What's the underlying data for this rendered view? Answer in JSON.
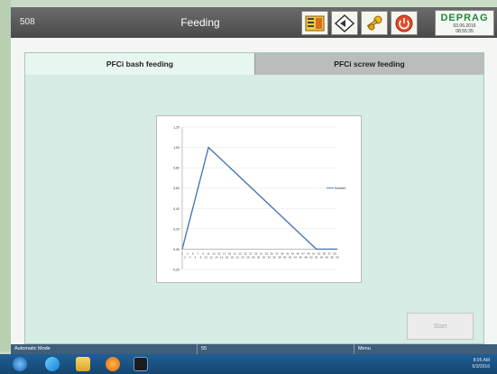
{
  "header": {
    "screen_id": "508",
    "title": "Feeding",
    "brand": "DEPRAG",
    "date": "03.06.2016",
    "time": "08:55:35"
  },
  "tabs": [
    {
      "label": "PFCi bash feeding",
      "active": true
    },
    {
      "label": "PFCi screw feeding",
      "active": false
    }
  ],
  "start_label": "Start",
  "statusbar": {
    "mode": "Automatic Mode",
    "value": "55",
    "menu": "Menu"
  },
  "taskbar": {
    "time": "8:05 AM",
    "date": "6/3/2016"
  },
  "chart_data": {
    "type": "line",
    "legend": "Sollwert",
    "legend_position": "right",
    "ylim": [
      -0.2,
      1.2
    ],
    "yticks": [
      "-0,20",
      "0,00",
      "0,20",
      "0,40",
      "0,60",
      "0,80",
      "1,00",
      "1,20"
    ],
    "x": [
      1,
      2,
      3,
      4,
      5,
      6,
      7,
      8,
      9,
      10,
      11,
      12,
      13,
      14,
      15,
      16,
      17,
      18,
      19,
      20,
      21,
      22,
      23,
      24,
      25,
      26,
      27,
      28,
      29,
      30,
      31,
      32,
      33,
      34,
      35,
      36,
      37,
      38,
      39,
      40,
      41,
      42,
      43,
      44,
      45,
      46,
      47,
      48,
      49,
      50,
      51,
      52,
      53,
      54,
      55,
      56,
      57,
      58,
      59,
      60
    ],
    "points": [
      [
        1,
        0
      ],
      [
        11,
        1
      ],
      [
        52,
        0
      ],
      [
        60,
        0
      ]
    ],
    "grid": true,
    "line_color": "#4a78b8"
  }
}
